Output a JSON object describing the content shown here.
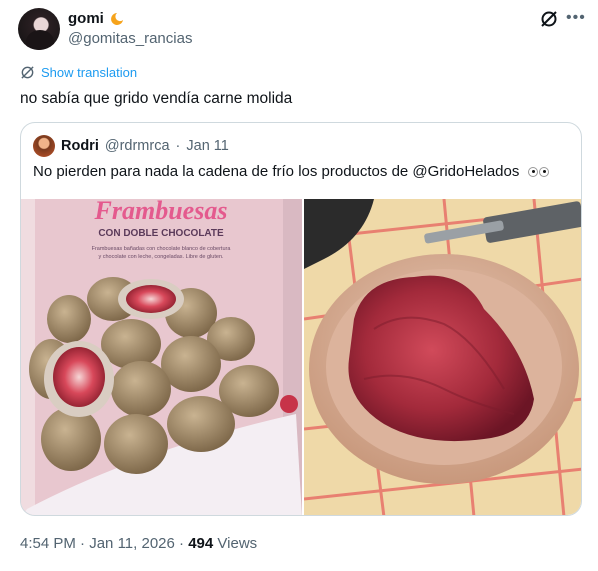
{
  "post": {
    "display_name": "gomi",
    "handle": "@gomitas_rancias",
    "translate_label": "Show translation",
    "text": "no sabía que grido vendía carne molida",
    "time": "4:54 PM",
    "date": "Jan 11, 2026",
    "separator": "·",
    "views_count": "494",
    "views_label": "Views"
  },
  "quote": {
    "display_name": "Rodri",
    "handle": "@rdrmrca",
    "separator": "·",
    "date": "Jan 11",
    "text": "No pierden para nada la cadena de frío los productos de @GridoHelados",
    "package": {
      "title": "Frambuesas",
      "subtitle": "CON DOBLE CHOCOLATE",
      "description_line1": "Frambuesas bañadas con chocolate blanco de cobertura",
      "description_line2": "y chocolate con leche, congeladas. Libre de gluten."
    }
  },
  "colors": {
    "link_blue": "#1d9bf0",
    "secondary_text": "#536471",
    "border": "#cfd9de"
  },
  "icons": [
    "moon-icon",
    "grok-icon",
    "more-icon",
    "translate-icon",
    "eyes-emoji"
  ]
}
